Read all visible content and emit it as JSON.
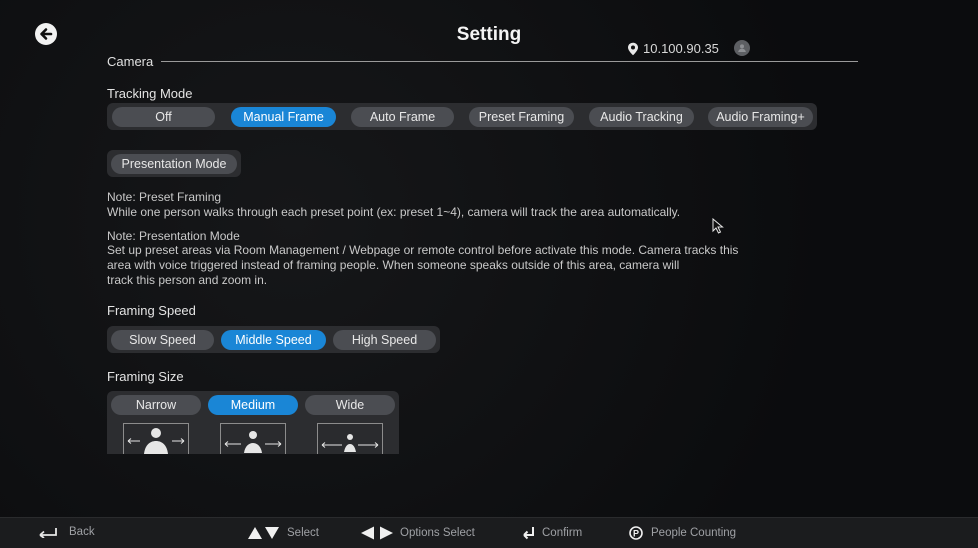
{
  "header": {
    "title": "Setting",
    "ip_address": "10.100.90.35"
  },
  "camera": {
    "section_label": "Camera",
    "tracking_mode": {
      "label": "Tracking Mode",
      "options": [
        "Off",
        "Manual Frame",
        "Auto Frame",
        "Preset Framing",
        "Audio Tracking",
        "Audio Framing+"
      ],
      "selected": "Manual Frame"
    },
    "presentation_mode_label": "Presentation Mode",
    "notes": {
      "preset_title": "Note: Preset Framing",
      "preset_body": "While one person walks through each preset point (ex: preset 1~4), camera will track the area automatically.",
      "presentation_title": "Note: Presentation Mode",
      "presentation_line1": "Set up preset areas via Room Management / Webpage or remote control before activate this mode. Camera tracks this",
      "presentation_line2": "area with voice triggered instead of framing people. When someone speaks outside of this area, camera will",
      "presentation_line3": "track this person and zoom in."
    },
    "framing_speed": {
      "label": "Framing Speed",
      "options": [
        "Slow Speed",
        "Middle Speed",
        "High Speed"
      ],
      "selected": "Middle Speed"
    },
    "framing_size": {
      "label": "Framing Size",
      "options": [
        "Narrow",
        "Medium",
        "Wide"
      ],
      "selected": "Medium"
    }
  },
  "footer": {
    "back": "Back",
    "select": "Select",
    "options_select": "Options Select",
    "confirm": "Confirm",
    "people_counting": "People Counting"
  },
  "colors": {
    "accent": "#1a86d6",
    "pill": "#4b4d52",
    "group_bg": "#2c2d30"
  }
}
